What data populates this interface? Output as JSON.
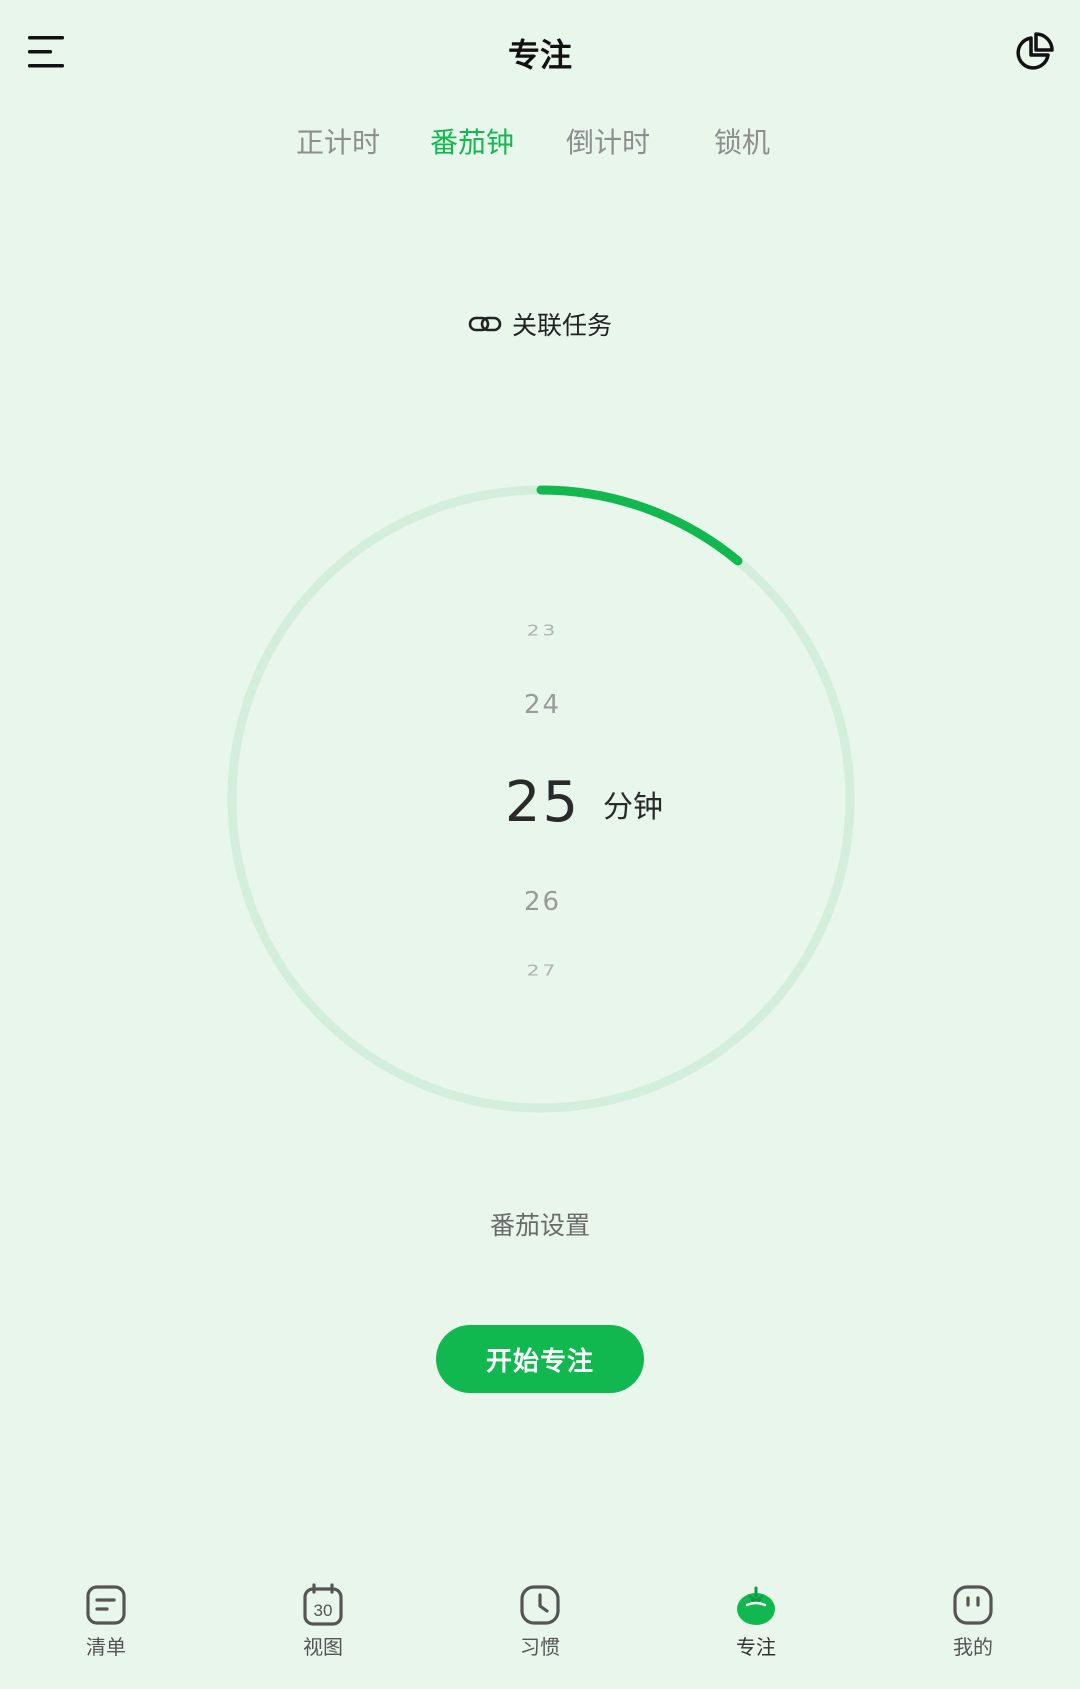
{
  "header": {
    "title": "专注",
    "menu_icon": "menu-icon",
    "stats_icon": "pie-chart-icon"
  },
  "tabs": [
    {
      "label": "正计时",
      "active": false
    },
    {
      "label": "番茄钟",
      "active": true
    },
    {
      "label": "倒计时",
      "active": false
    },
    {
      "label": "锁机",
      "active": false
    }
  ],
  "link_task": {
    "label": "关联任务",
    "icon": "link-icon"
  },
  "timer": {
    "picker_values": [
      "23",
      "24",
      "25",
      "26",
      "27"
    ],
    "selected_value": "25",
    "unit": "分钟",
    "progress_fraction": 0.11
  },
  "pomo_settings_label": "番茄设置",
  "start_button_label": "开始专注",
  "colors": {
    "accent": "#11b84f",
    "background": "#e8f6eb",
    "track": "#d3efdc"
  },
  "bottom_nav": [
    {
      "label": "清单",
      "icon": "list-icon",
      "active": false
    },
    {
      "label": "视图",
      "icon": "calendar-icon",
      "calendar_day": "30",
      "active": false
    },
    {
      "label": "习惯",
      "icon": "clock-icon",
      "active": false
    },
    {
      "label": "专注",
      "icon": "tomato-icon",
      "active": true
    },
    {
      "label": "我的",
      "icon": "profile-icon",
      "active": false
    }
  ]
}
